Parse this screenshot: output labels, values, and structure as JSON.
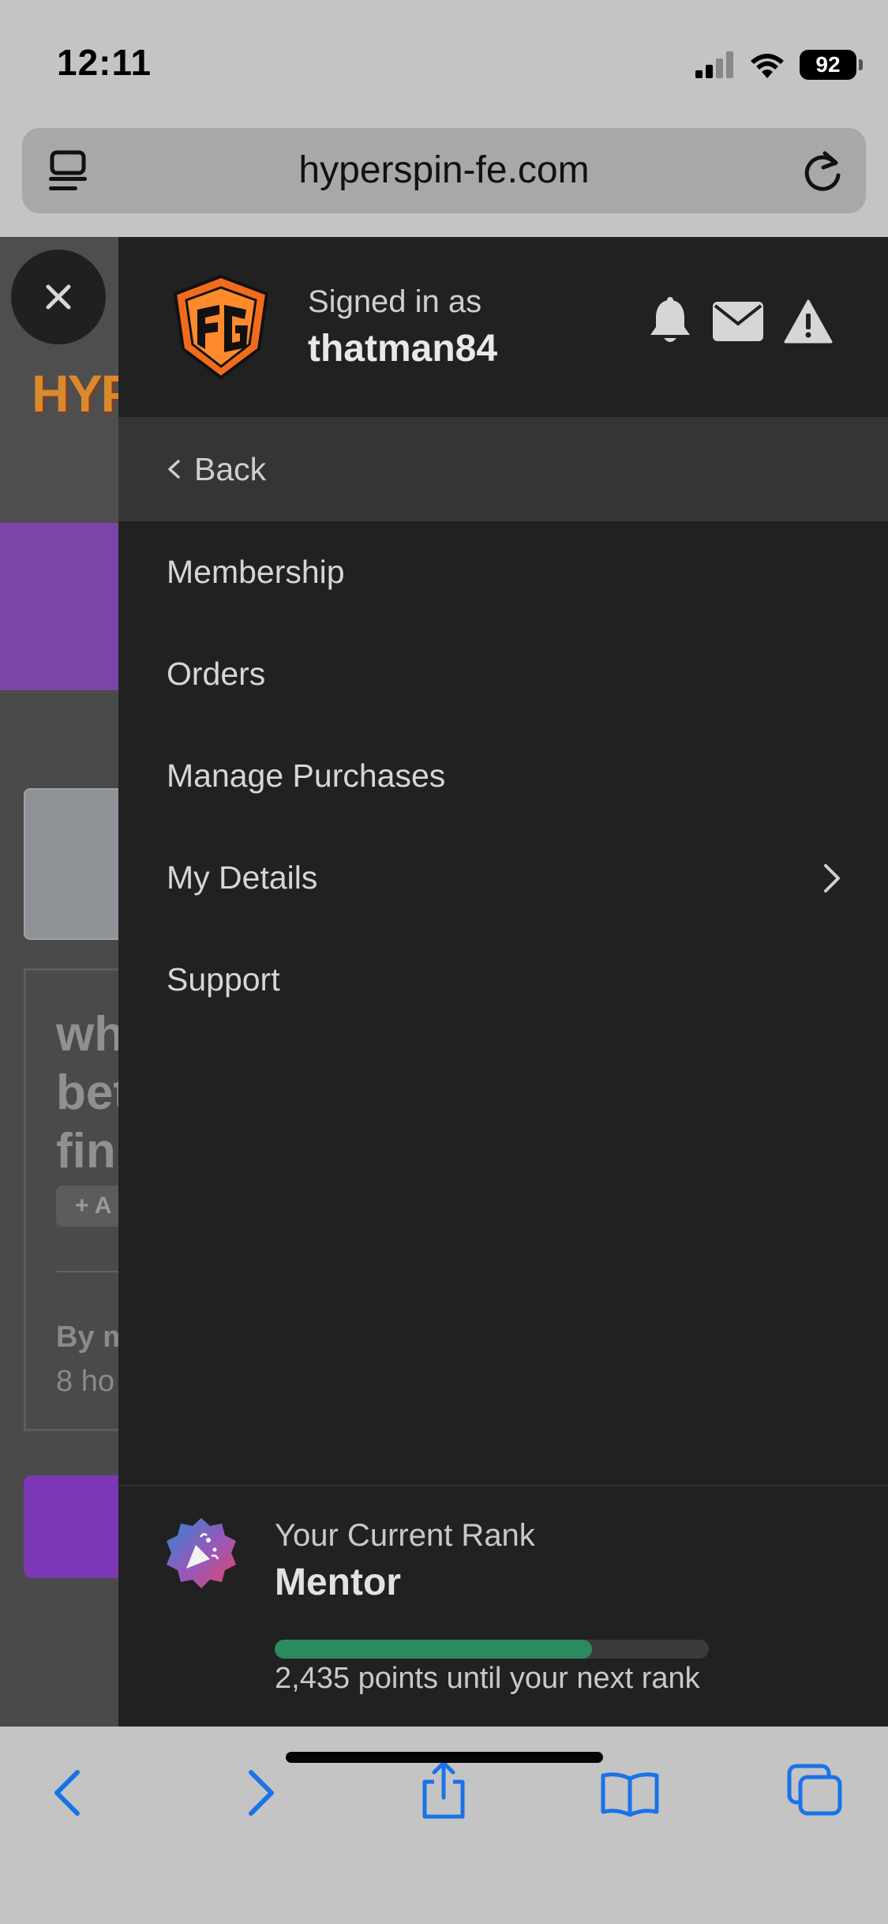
{
  "status_bar": {
    "time": "12:11",
    "battery": "92"
  },
  "browser": {
    "url": "hyperspin-fe.com"
  },
  "background_page": {
    "logo_text": "HYP",
    "card_title_lines": [
      "wh",
      "bet",
      "fin"
    ],
    "add_button": "+ A",
    "by_text": "By m",
    "time_text": "8 ho"
  },
  "drawer": {
    "signed_in_label": "Signed in as",
    "username": "thatman84",
    "back_label": "Back",
    "menu": [
      {
        "label": "Membership",
        "has_submenu": false
      },
      {
        "label": "Orders",
        "has_submenu": false
      },
      {
        "label": "Manage Purchases",
        "has_submenu": false
      },
      {
        "label": "My Details",
        "has_submenu": true
      },
      {
        "label": "Support",
        "has_submenu": false
      }
    ],
    "rank": {
      "label": "Your Current Rank",
      "name": "Mentor",
      "progress_fraction": 0.73,
      "points_text": "2,435 points until your next rank"
    }
  },
  "colors": {
    "drawer_bg": "#212121",
    "back_row_bg": "#353535",
    "progress": "#2c8a5f",
    "safari_blue": "#1a73e8",
    "logo_orange": "#f26b1d"
  },
  "icons": {
    "header": [
      "bell-icon",
      "envelope-icon",
      "warning-icon"
    ],
    "toolbar": [
      "back-icon",
      "forward-icon",
      "share-icon",
      "bookmarks-icon",
      "tabs-icon"
    ]
  }
}
